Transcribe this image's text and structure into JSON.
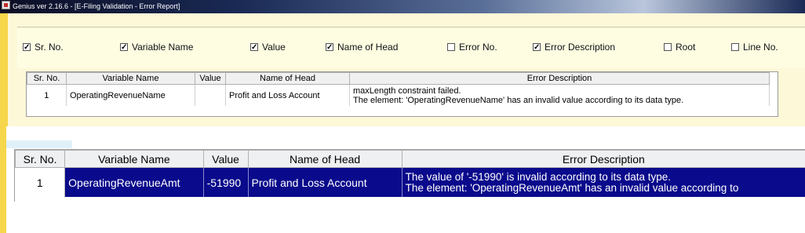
{
  "window": {
    "title": "Genius ver 2.16.6 - [E-Filing Validation - Error Report]"
  },
  "options": [
    {
      "label": "Sr. No.",
      "checked": true
    },
    {
      "label": "Variable Name",
      "checked": true
    },
    {
      "label": "Value",
      "checked": true
    },
    {
      "label": "Name of Head",
      "checked": true
    },
    {
      "label": "Error No.",
      "checked": false
    },
    {
      "label": "Error Description",
      "checked": true
    },
    {
      "label": "Root",
      "checked": false
    },
    {
      "label": "Line No.",
      "checked": false
    }
  ],
  "table1": {
    "headers": [
      "Sr. No.",
      "Variable Name",
      "Value",
      "Name of Head",
      "Error Description"
    ],
    "rows": [
      {
        "sr": "1",
        "variable": "OperatingRevenueName",
        "value": "",
        "head": "Profit and Loss Account",
        "error_line1": "maxLength constraint failed.",
        "error_line2": "The element: 'OperatingRevenueName'  has an invalid value according to its data type."
      }
    ]
  },
  "table2": {
    "headers": [
      "Sr. No.",
      "Variable Name",
      "Value",
      "Name of Head",
      "Error Description"
    ],
    "rows": [
      {
        "sr": "1",
        "variable": "OperatingRevenueAmt",
        "value": "-51990",
        "head": "Profit and Loss Account",
        "error_line1": "The value of '-51990' is invalid according to its data type.",
        "error_line2": "The element: 'OperatingRevenueAmt'  has an invalid value according to"
      }
    ]
  },
  "colors": {
    "selection": "#0a0a8c",
    "panel": "#fdf8d8",
    "accent_strip": "#f6d64a"
  }
}
